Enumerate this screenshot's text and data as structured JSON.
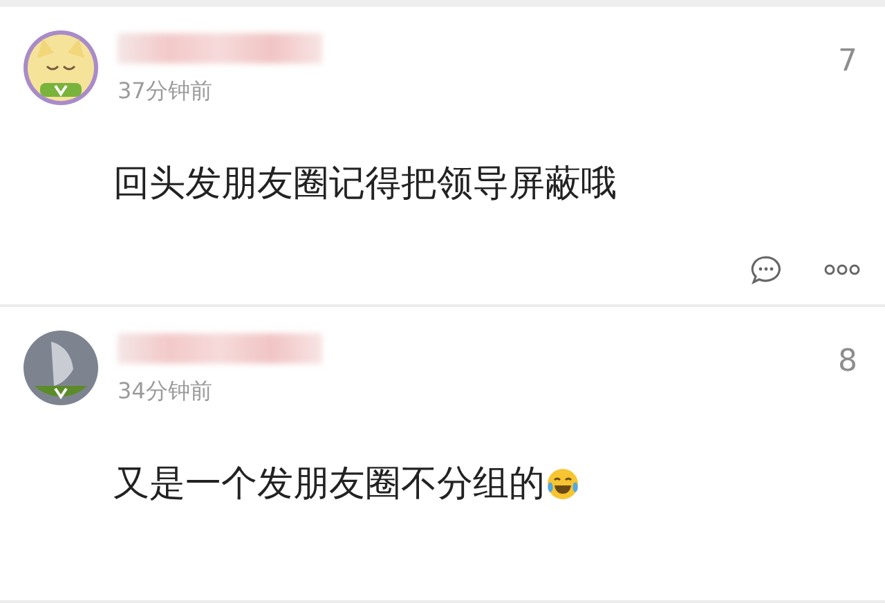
{
  "comments": [
    {
      "kind": "cartoon",
      "time": "37分钟前",
      "count": "7",
      "text": "回头发朋友圈记得把领导屏蔽哦",
      "emoji": false,
      "actions": true
    },
    {
      "kind": "photo",
      "time": "34分钟前",
      "count": "8",
      "text": "又是一个发朋友圈不分组的",
      "emoji": true,
      "actions": false
    }
  ]
}
